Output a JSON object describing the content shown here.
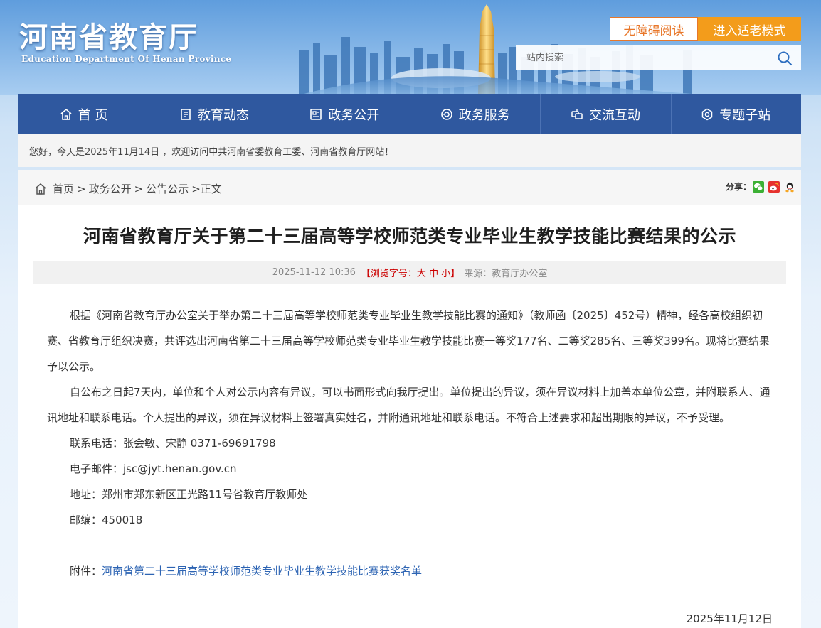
{
  "header": {
    "logo_cn": "河南省教育厅",
    "logo_en": "Education Department Of Henan Province",
    "accessibility_btn": "无障碍阅读",
    "elder_mode_btn": "进入适老模式",
    "search_placeholder": "站内搜索"
  },
  "nav": {
    "items": [
      {
        "label": "首 页",
        "icon": "home-icon"
      },
      {
        "label": "教育动态",
        "icon": "news-icon"
      },
      {
        "label": "政务公开",
        "icon": "document-icon"
      },
      {
        "label": "政务服务",
        "icon": "service-icon"
      },
      {
        "label": "交流互动",
        "icon": "interaction-icon"
      },
      {
        "label": "专题子站",
        "icon": "topic-icon"
      }
    ]
  },
  "welcome_text": "您好，今天是2025年11月14日 ，欢迎访问中共河南省委教育工委、河南省教育厅网站！",
  "breadcrumb": {
    "home": "首页",
    "level1": "政务公开",
    "level2": "公告公示",
    "current": "正文",
    "sep": ">"
  },
  "share": {
    "label": "分享：",
    "icons": [
      "wechat-icon",
      "weibo-icon",
      "qq-icon"
    ]
  },
  "article": {
    "title": "河南省教育厅关于第二十三届高等学校师范类专业毕业生教学技能比赛结果的公示",
    "meta": {
      "datetime": "2025-11-12 10:36",
      "fontsize_prefix": "【浏览字号：",
      "fontsize_large": "大",
      "fontsize_medium": "中",
      "fontsize_small": "小",
      "fontsize_suffix": "】",
      "source": "来源：教育厅办公室"
    },
    "paragraph1": "根据《河南省教育厅办公室关于举办第二十三届高等学校师范类专业毕业生教学技能比赛的通知》（教师函〔2025〕452号）精神，经各高校组织初赛、省教育厅组织决赛，共评选出河南省第二十三届高等学校师范类专业毕业生教学技能比赛一等奖177名、二等奖285名、三等奖399名。现将比赛结果予以公示。",
    "paragraph2": "自公布之日起7天内，单位和个人对公示内容有异议，可以书面形式向我厅提出。单位提出的异议，须在异议材料上加盖本单位公章，并附联系人、通讯地址和联系电话。个人提出的异议，须在异议材料上签署真实姓名，并附通讯地址和联系电话。不符合上述要求和超出期限的异议，不予受理。",
    "contact": "联系电话：张会敏、宋静 0371-69691798",
    "email": "电子邮件：jsc@jyt.henan.gov.cn",
    "address": "地址：郑州市郑东新区正光路11号省教育厅教师处",
    "postcode": "邮编：450018",
    "attachment_label": "附件：",
    "attachment_link": "河南省第二十三届高等学校师范类专业毕业生教学技能比赛获奖名单",
    "sign_date": "2025年11月12日"
  }
}
